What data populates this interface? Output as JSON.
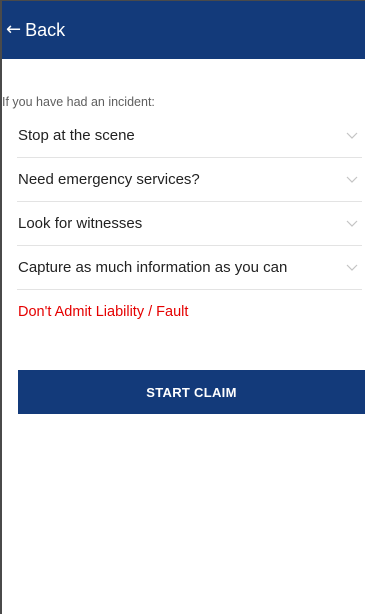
{
  "header": {
    "back_icon": "left-arrow-icon",
    "back_label": "Back",
    "background_color": "#133a7a"
  },
  "intro_text": "If you have had an incident:",
  "steps": [
    {
      "label": "Stop at the scene",
      "icon": "chevron-down-icon"
    },
    {
      "label": "Need emergency services?",
      "icon": "chevron-down-icon"
    },
    {
      "label": "Look for witnesses",
      "icon": "chevron-down-icon"
    },
    {
      "label": "Capture as much information as you can",
      "icon": "chevron-down-icon"
    }
  ],
  "warning_text": "Don't Admit Liability / Fault",
  "warning_color": "#e50000",
  "start_claim_label": "START CLAIM"
}
